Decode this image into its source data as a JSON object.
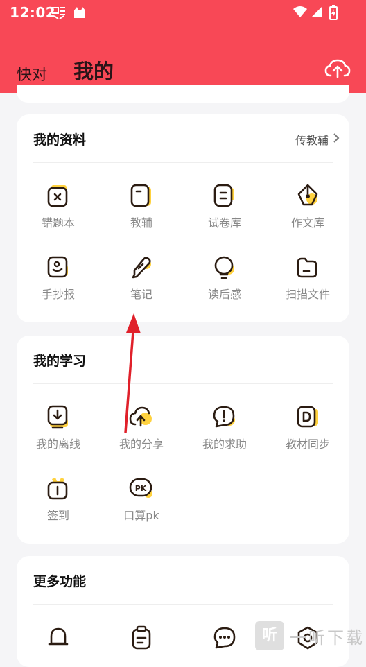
{
  "status_bar": {
    "time": "12:02"
  },
  "header": {
    "tab_1": "快对",
    "tab_2": "我的"
  },
  "colors": {
    "header_bg": "#f84856",
    "accent_yellow": "#ffd23f",
    "icon_stroke": "#2b1c12",
    "label_gray": "#888888",
    "arrow_red": "#e0202a"
  },
  "my_materials": {
    "title": "我的资料",
    "link": "传教辅",
    "items": [
      {
        "label": "错题本",
        "icon": "wrong-question-book-icon"
      },
      {
        "label": "教辅",
        "icon": "teaching-aid-icon"
      },
      {
        "label": "试卷库",
        "icon": "exam-library-icon"
      },
      {
        "label": "作文库",
        "icon": "essay-library-icon"
      },
      {
        "label": "手抄报",
        "icon": "handwritten-newspaper-icon"
      },
      {
        "label": "笔记",
        "icon": "notes-icon"
      },
      {
        "label": "读后感",
        "icon": "reading-reflection-icon"
      },
      {
        "label": "扫描文件",
        "icon": "scan-files-icon"
      }
    ]
  },
  "my_study": {
    "title": "我的学习",
    "items": [
      {
        "label": "我的离线",
        "icon": "offline-download-icon"
      },
      {
        "label": "我的分享",
        "icon": "share-upload-icon"
      },
      {
        "label": "我的求助",
        "icon": "help-request-icon"
      },
      {
        "label": "教材同步",
        "icon": "textbook-sync-icon"
      },
      {
        "label": "签到",
        "icon": "check-in-icon"
      },
      {
        "label": "口算pk",
        "icon": "mental-math-pk-icon"
      }
    ]
  },
  "more_features": {
    "title": "更多功能"
  },
  "watermark": {
    "text": "一听下载",
    "box": "听"
  }
}
